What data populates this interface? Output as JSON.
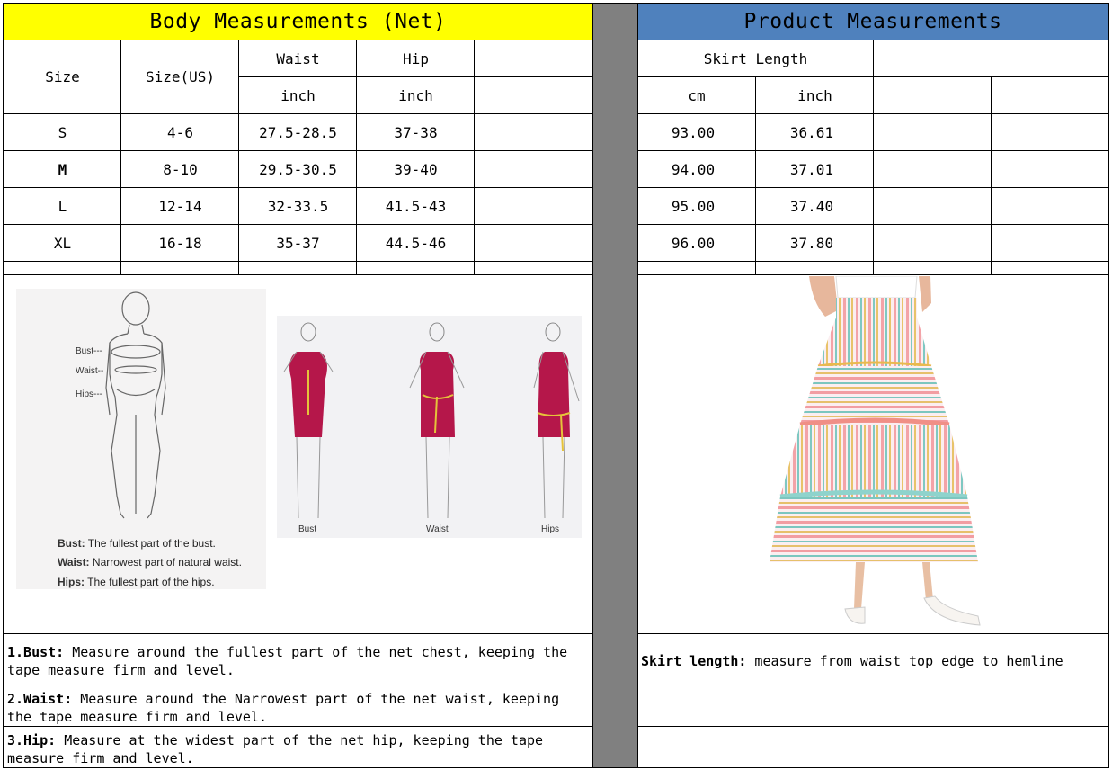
{
  "colors": {
    "body_header_bg": "#ffff00",
    "product_header_bg": "#4f81bd",
    "divider_gray": "#808080",
    "dress_red": "#b5174a"
  },
  "body_table": {
    "title": "Body Measurements (Net)",
    "col_size": "Size",
    "col_size_us": "Size(US)",
    "col_waist": "Waist",
    "col_hip": "Hip",
    "unit_waist": "inch",
    "unit_hip": "inch",
    "rows": [
      {
        "size": "S",
        "us": "4-6",
        "waist": "27.5-28.5",
        "hip": "37-38"
      },
      {
        "size": "M",
        "us": "8-10",
        "waist": "29.5-30.5",
        "hip": "39-40"
      },
      {
        "size": "L",
        "us": "12-14",
        "waist": "32-33.5",
        "hip": "41.5-43"
      },
      {
        "size": "XL",
        "us": "16-18",
        "waist": "35-37",
        "hip": "44.5-46"
      }
    ]
  },
  "product_table": {
    "title": "Product Measurements",
    "col_skirt_length": "Skirt Length",
    "unit_cm": "cm",
    "unit_inch": "inch",
    "rows": [
      {
        "cm": "93.00",
        "inch": "36.61"
      },
      {
        "cm": "94.00",
        "inch": "37.01"
      },
      {
        "cm": "95.00",
        "inch": "37.40"
      },
      {
        "cm": "96.00",
        "inch": "37.80"
      }
    ]
  },
  "figure": {
    "label_bust": "Bust---",
    "label_waist": "Waist--",
    "label_hips": "Hips---",
    "cap_bust_title": "Bust:",
    "cap_bust_text": "The fullest part of the bust.",
    "cap_waist_title": "Waist:",
    "cap_waist_text": "Narrowest part of natural waist.",
    "cap_hips_title": "Hips:",
    "cap_hips_text": "The fullest part of the hips.",
    "dress_bust": "Bust",
    "dress_waist": "Waist",
    "dress_hips": "Hips"
  },
  "notes": {
    "bust_title": "1.Bust:",
    "bust_text": " Measure around the fullest part of the net chest, keeping the tape  measure firm and level.",
    "waist_title": "2.Waist:",
    "waist_text": " Measure around the Narrowest part of the net waist, keeping the tape  measure firm and level.",
    "hip_title": "3.Hip:",
    "hip_text": " Measure at the widest part of the net hip, keeping the tape measure firm and level.",
    "skirt_title": "Skirt length:",
    "skirt_text": " measure from waist top edge to hemline"
  }
}
